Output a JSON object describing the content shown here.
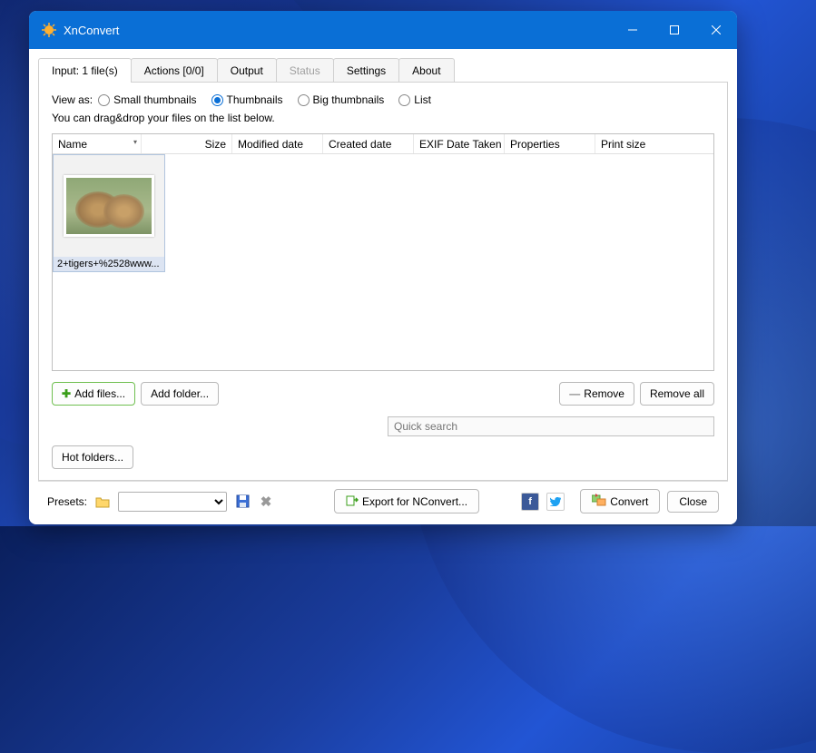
{
  "window": {
    "title": "XnConvert"
  },
  "tabs": [
    {
      "label": "Input: 1 file(s)",
      "state": "active"
    },
    {
      "label": "Actions [0/0]",
      "state": "normal"
    },
    {
      "label": "Output",
      "state": "normal"
    },
    {
      "label": "Status",
      "state": "disabled"
    },
    {
      "label": "Settings",
      "state": "normal"
    },
    {
      "label": "About",
      "state": "normal"
    }
  ],
  "view": {
    "label": "View as:",
    "options": [
      "Small thumbnails",
      "Thumbnails",
      "Big thumbnails",
      "List"
    ],
    "selected": "Thumbnails"
  },
  "hint": "You can drag&drop your files on the list below.",
  "columns": [
    {
      "name": "Name",
      "width": 98,
      "sorted": true
    },
    {
      "name": "Size",
      "width": 100,
      "align": "right"
    },
    {
      "name": "Modified date",
      "width": 100
    },
    {
      "name": "Created date",
      "width": 100
    },
    {
      "name": "EXIF Date Taken",
      "width": 100
    },
    {
      "name": "Properties",
      "width": 100
    },
    {
      "name": "Print size",
      "width": 100
    }
  ],
  "files": [
    {
      "caption": "2+tigers+%2528www..."
    }
  ],
  "buttons": {
    "add_files": "Add files...",
    "add_folder": "Add folder...",
    "remove": "Remove",
    "remove_all": "Remove all",
    "hot_folders": "Hot folders...",
    "export": "Export for NConvert...",
    "convert": "Convert",
    "close": "Close"
  },
  "search": {
    "placeholder": "Quick search"
  },
  "bottom": {
    "presets_label": "Presets:"
  }
}
